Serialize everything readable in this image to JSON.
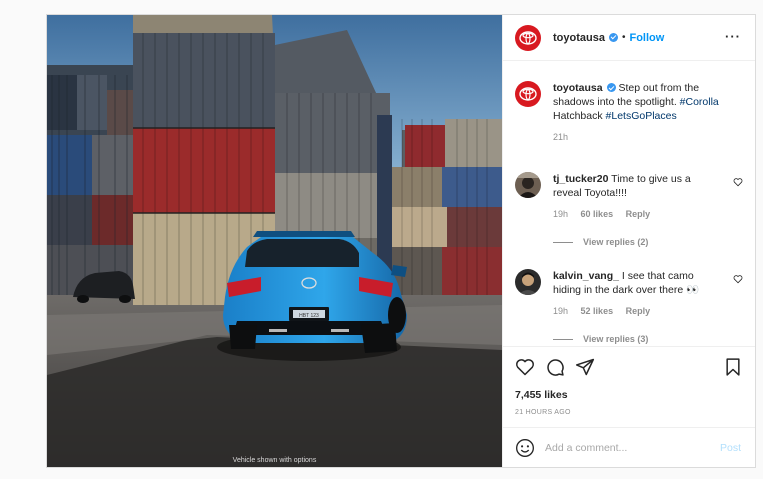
{
  "photo": {
    "caption": "Vehicle shown with options",
    "plate": "HBT 123"
  },
  "header": {
    "username": "toyotausa",
    "separator": "•",
    "follow_label": "Follow",
    "more_label": "···"
  },
  "comments": [
    {
      "username": "toyotausa",
      "text_before": " Step out from the shadows into the spotlight. ",
      "tag1": "#Corolla",
      "text_mid": " Hatchback ",
      "tag2": "#LetsGoPlaces",
      "time": "21h"
    },
    {
      "username": "tj_tucker20",
      "text": " Time to give us a reveal Toyota!!!!",
      "time": "19h",
      "likes": "60 likes",
      "reply_label": "Reply",
      "view_replies": "View replies (2)"
    },
    {
      "username": "kalvin_vang_",
      "text": " I see that camo hiding in the dark over there 👀",
      "time": "19h",
      "likes": "52 likes",
      "reply_label": "Reply",
      "view_replies": "View replies (3)"
    }
  ],
  "actions": {
    "likes": "7,455 likes",
    "ago": "21 HOURS AGO"
  },
  "add_comment": {
    "placeholder": "Add a comment...",
    "post_label": "Post"
  },
  "colors": {
    "brand_red": "#d81920",
    "link_blue": "#0095f6",
    "verified_blue": "#3897f0"
  }
}
